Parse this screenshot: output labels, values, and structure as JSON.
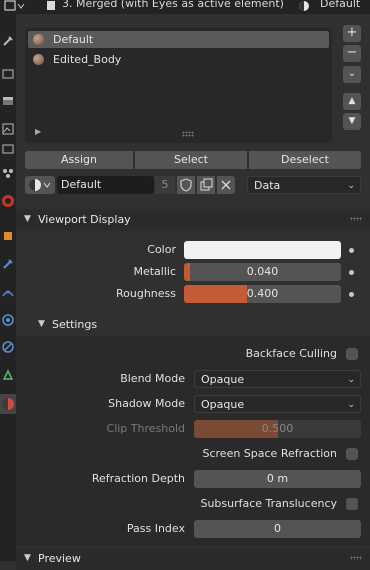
{
  "header": {
    "object_title": "3. Merged (with Eyes as active element)",
    "material_title": "Default"
  },
  "material_slots": [
    {
      "name": "Default",
      "selected": true
    },
    {
      "name": "Edited_Body",
      "selected": false
    }
  ],
  "slot_buttons": {
    "add": "+",
    "remove": "−",
    "menu": "⌄",
    "up": "▲",
    "down": "▼"
  },
  "slot_actions": {
    "assign": "Assign",
    "select": "Select",
    "deselect": "Deselect"
  },
  "material_selector": {
    "name": "Default",
    "users": "5",
    "link": "Data"
  },
  "viewport_display": {
    "title": "Viewport Display",
    "color_label": "Color",
    "color_value": "#f2f2f2",
    "metallic_label": "Metallic",
    "metallic_value": "0.040",
    "metallic_fraction": 0.04,
    "roughness_label": "Roughness",
    "roughness_value": "0.400",
    "roughness_fraction": 0.4
  },
  "settings": {
    "title": "Settings",
    "backface_culling": "Backface Culling",
    "blend_mode_label": "Blend Mode",
    "blend_mode": "Opaque",
    "shadow_mode_label": "Shadow Mode",
    "shadow_mode": "Opaque",
    "clip_threshold_label": "Clip Threshold",
    "clip_threshold_value": "0.500",
    "clip_threshold_fraction": 0.5,
    "ssr_label": "Screen Space Refraction",
    "refraction_depth_label": "Refraction Depth",
    "refraction_depth_value": "0 m",
    "sss_label": "Subsurface Translucency",
    "pass_index_label": "Pass Index",
    "pass_index_value": "0"
  },
  "preview": {
    "title": "Preview"
  },
  "colors": {
    "accent": "#c45b34",
    "panel": "#303030",
    "field": "#545454"
  }
}
